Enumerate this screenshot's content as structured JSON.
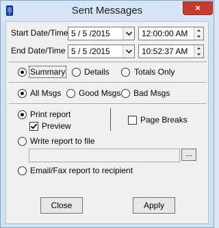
{
  "window": {
    "title": "Sent Messages",
    "close_glyph": "×",
    "icon": "device-icon"
  },
  "dates": {
    "start_label": "Start Date/Time",
    "start_date": "5 / 5 /2015",
    "start_time": "12:00:00 AM",
    "end_label": "End Date/Time",
    "end_date": "5 / 5 /2015",
    "end_time": "10:52:37 AM"
  },
  "report_type": {
    "options": [
      "Summary",
      "Details",
      "Totals Only"
    ],
    "selected": "Summary"
  },
  "message_filter": {
    "options": [
      "All Msgs",
      "Good Msgs",
      "Bad Msgs"
    ],
    "selected": "All Msgs"
  },
  "output": {
    "print_label": "Print report",
    "preview_label": "Preview",
    "preview_checked": true,
    "page_breaks_label": "Page Breaks",
    "page_breaks_checked": false,
    "file_label": "Write report to file",
    "file_path": "",
    "browse_label": "...",
    "email_label": "Email/Fax report to recipient",
    "selected": "Print report"
  },
  "buttons": {
    "close": "Close",
    "apply": "Apply"
  }
}
